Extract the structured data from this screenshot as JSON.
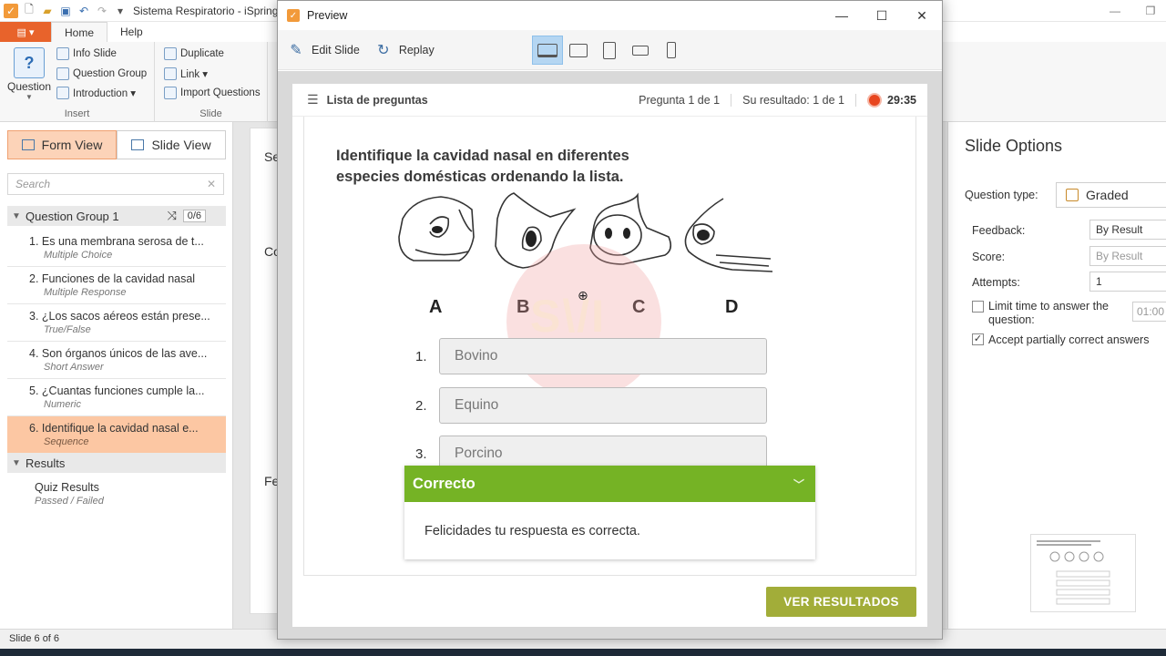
{
  "app": {
    "title": "Sistema Respiratorio - iSpring",
    "colors": {
      "accent": "#e8632b",
      "selected": "#fcc7a3",
      "success": "#75b325",
      "button": "#a2ad39"
    }
  },
  "ribbon": {
    "file_tab": "▤ ▾",
    "tabs": [
      "Home",
      "Help"
    ],
    "question_label": "Question",
    "insert": {
      "info_slide": "Info Slide",
      "question_group": "Question Group",
      "introduction": "Introduction ▾",
      "label": "Insert"
    },
    "slide": {
      "duplicate": "Duplicate",
      "link": "Link ▾",
      "import_questions": "Import Questions",
      "label": "Slide"
    }
  },
  "left_panel": {
    "form_view": "Form View",
    "slide_view": "Slide View",
    "search_placeholder": "Search",
    "group_title": "Question Group 1",
    "group_count": "0/6",
    "questions": [
      {
        "num": "1.",
        "title": "Es una membrana serosa de t...",
        "type": "Multiple Choice"
      },
      {
        "num": "2.",
        "title": "Funciones de la cavidad nasal",
        "type": "Multiple Response"
      },
      {
        "num": "3.",
        "title": "¿Los sacos aéreos están prese...",
        "type": "True/False"
      },
      {
        "num": "4.",
        "title": "Son órganos únicos de las ave...",
        "type": "Short Answer"
      },
      {
        "num": "5.",
        "title": "¿Cuantas funciones cumple la...",
        "type": "Numeric"
      },
      {
        "num": "6.",
        "title": "Identifique la cavidad nasal e...",
        "type": "Sequence"
      }
    ],
    "results_header": "Results",
    "results_item": {
      "title": "Quiz Results",
      "subtitle": "Passed / Failed"
    }
  },
  "middle": {
    "lbl1": "Se",
    "lbl2": "Co",
    "lbl3": "Fe"
  },
  "right_panel": {
    "title": "Slide Options",
    "question_type_label": "Question type:",
    "question_type_value": "Graded",
    "feedback_label": "Feedback:",
    "feedback_value": "By Result",
    "score_label": "Score:",
    "score_value": "By Result",
    "attempts_label": "Attempts:",
    "attempts_value": "1",
    "limit_time_label": "Limit time to answer the question:",
    "limit_time_value": "01:00",
    "partial_label": "Accept partially correct answers",
    "partial_checked": true
  },
  "status_bar": {
    "slide_info": "Slide 6 of 6"
  },
  "preview": {
    "window_title": "Preview",
    "edit_slide": "Edit Slide",
    "replay": "Replay",
    "question_list": "Lista de preguntas",
    "question_counter": "Pregunta 1 de 1",
    "result": "Su resultado: 1 de 1",
    "timer": "29:35",
    "question_text": "Identifique la cavidad nasal en diferentes especies domésticas ordenando la lista.",
    "figure_labels": [
      "A",
      "B",
      "C",
      "D"
    ],
    "sequence": [
      {
        "num": "1.",
        "value": "Bovino"
      },
      {
        "num": "2.",
        "value": "Equino"
      },
      {
        "num": "3.",
        "value": "Porcino"
      }
    ],
    "feedback_title": "Correcto",
    "feedback_message": "Felicidades tu respuesta es correcta.",
    "results_button": "VER RESULTADOS"
  }
}
